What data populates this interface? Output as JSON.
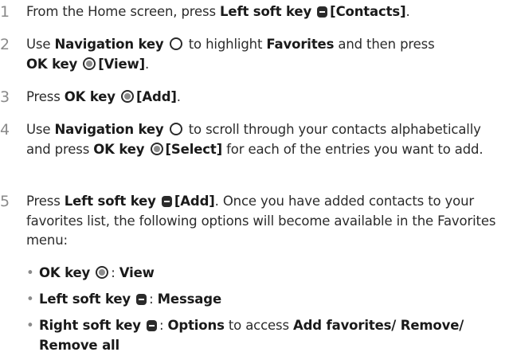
{
  "steps": [
    {
      "num": "1",
      "a": "From the Home screen, press ",
      "b": "Left soft key",
      "c": "[Contacts]",
      "d": "."
    },
    {
      "num": "2",
      "a": "Use ",
      "b": "Navigation key",
      "c": " to highlight ",
      "d": "Favorites",
      "e": " and then press ",
      "f": "OK key",
      "g": "[View]",
      "h": "."
    },
    {
      "num": "3",
      "a": "Press ",
      "b": "OK key",
      "c": "[Add]",
      "d": "."
    },
    {
      "num": "4",
      "a": "Use ",
      "b": "Navigation key",
      "c": " to scroll through your contacts alphabetically and press ",
      "d": "OK key",
      "e": "[Select]",
      "f": " for each of the entries you want to add."
    },
    {
      "num": "5",
      "a": "Press ",
      "b": "Left soft key",
      "c": "[Add]",
      "d": ". Once you have added contacts to your favorites list, the following options will become available in the Favorites menu:"
    }
  ],
  "bullets": [
    {
      "dot": "•",
      "key": "OK key",
      "sep": ": ",
      "label": "View"
    },
    {
      "dot": "•",
      "key": "Left soft key",
      "sep": ": ",
      "label": "Message"
    },
    {
      "dot": "•",
      "key": "Right soft key",
      "sep": ": ",
      "label": "Options",
      "rest": " to access ",
      "opts": "Add favorites/ Remove/ Remove all"
    }
  ],
  "icons": {
    "softkey": "soft-key-icon",
    "navkey": "navigation-key-icon",
    "okkey": "ok-key-icon"
  }
}
